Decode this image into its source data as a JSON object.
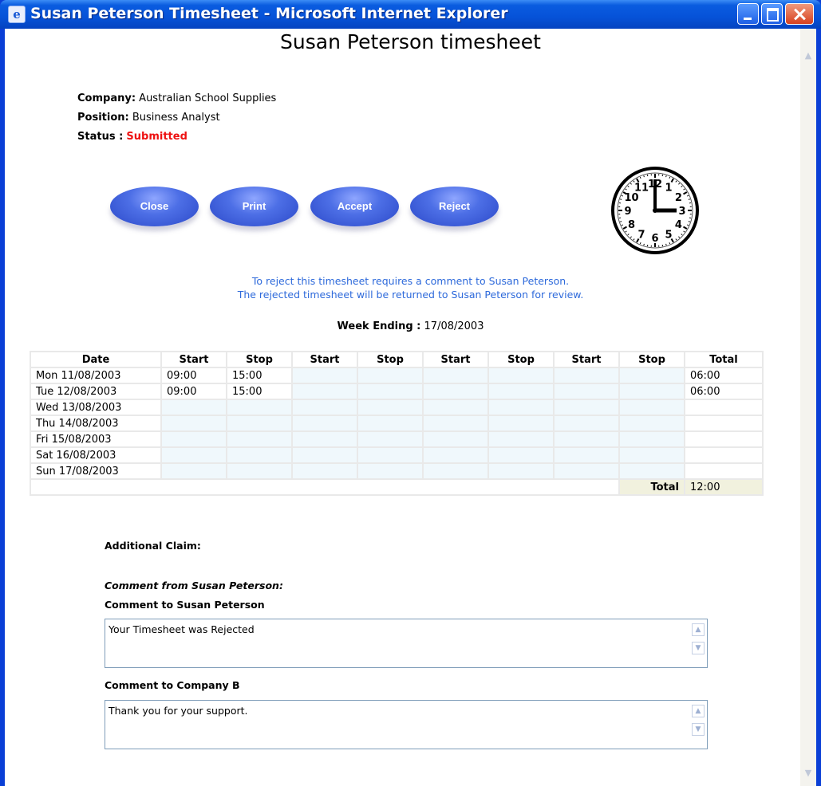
{
  "window": {
    "title": "Susan Peterson Timesheet - Microsoft Internet Explorer",
    "icon": "ie-icon"
  },
  "page": {
    "title": "Susan Peterson timesheet",
    "company_label": "Company:",
    "company": "Australian School Supplies",
    "position_label": "Position:",
    "position": "Business Analyst",
    "status_label": "Status :",
    "status": "Submitted"
  },
  "buttons": {
    "close": "Close",
    "print": "Print",
    "accept": "Accept",
    "reject": "Reject"
  },
  "clock": {
    "numbers": [
      "12",
      "1",
      "2",
      "3",
      "4",
      "5",
      "6",
      "7",
      "8",
      "9",
      "10",
      "11"
    ]
  },
  "notice": {
    "line1": "To reject this timesheet requires a comment to Susan Peterson.",
    "line2": "The rejected timesheet will be returned to Susan Peterson for review."
  },
  "week": {
    "label": "Week Ending :",
    "value": "17/08/2003"
  },
  "table": {
    "headers": [
      "Date",
      "Start",
      "Stop",
      "Start",
      "Stop",
      "Start",
      "Stop",
      "Start",
      "Stop",
      "Total"
    ],
    "rows": [
      {
        "date": "Mon 11/08/2003",
        "times": [
          "09:00",
          "15:00",
          "",
          "",
          "",
          "",
          "",
          ""
        ],
        "total": "06:00"
      },
      {
        "date": "Tue 12/08/2003",
        "times": [
          "09:00",
          "15:00",
          "",
          "",
          "",
          "",
          "",
          ""
        ],
        "total": "06:00"
      },
      {
        "date": "Wed 13/08/2003",
        "times": [
          "",
          "",
          "",
          "",
          "",
          "",
          "",
          ""
        ],
        "total": ""
      },
      {
        "date": "Thu 14/08/2003",
        "times": [
          "",
          "",
          "",
          "",
          "",
          "",
          "",
          ""
        ],
        "total": ""
      },
      {
        "date": "Fri 15/08/2003",
        "times": [
          "",
          "",
          "",
          "",
          "",
          "",
          "",
          ""
        ],
        "total": ""
      },
      {
        "date": "Sat 16/08/2003",
        "times": [
          "",
          "",
          "",
          "",
          "",
          "",
          "",
          ""
        ],
        "total": ""
      },
      {
        "date": "Sun 17/08/2003",
        "times": [
          "",
          "",
          "",
          "",
          "",
          "",
          "",
          ""
        ],
        "total": ""
      }
    ],
    "total_label": "Total",
    "total_value": "12:00"
  },
  "additional_claim": "Additional Claim:",
  "comment_from": "Comment from Susan Peterson:",
  "comment_to_susan": {
    "label": "Comment to Susan Peterson",
    "value": "Your Timesheet was Rejected"
  },
  "comment_to_company": {
    "label": "Comment to Company B",
    "value": "Thank you for your support."
  },
  "colors": {
    "titlebar": "#0a5ce0",
    "status": "#ee1111",
    "notice": "#2e6adb",
    "button": "#4d6fe6",
    "total_cell": "#f1f1de"
  }
}
